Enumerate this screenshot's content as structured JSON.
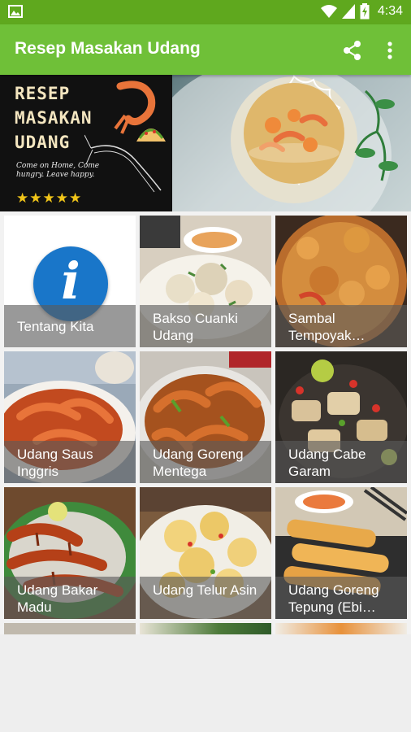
{
  "status_bar": {
    "time": "4:34",
    "icons": [
      "image-icon",
      "wifi-icon",
      "signal-icon",
      "battery-charging-icon"
    ]
  },
  "app_bar": {
    "title": "Resep Masakan Udang",
    "actions": [
      "share-icon",
      "more-vert-icon"
    ]
  },
  "banner": {
    "title_lines": [
      "RESEP",
      "MASAKAN",
      "UDANG"
    ],
    "tagline": "Come on Home, Come hungry. Leave happy.",
    "stars": "★★★★★",
    "rating": 5
  },
  "tiles": [
    {
      "label": "Tentang Kita",
      "icon": "info-icon"
    },
    {
      "label": "Bakso Cuanki Udang"
    },
    {
      "label": "Sambal Tempoyak…"
    },
    {
      "label": "Udang Saus Inggris"
    },
    {
      "label": "Udang Goreng Mentega"
    },
    {
      "label": "Udang Cabe Garam"
    },
    {
      "label": "Udang Bakar Madu"
    },
    {
      "label": "Udang Telur Asin"
    },
    {
      "label": "Udang Goreng Tepung (Ebi…"
    }
  ],
  "colors": {
    "status_bar": "#5fa81e",
    "app_bar": "#6fc038",
    "info_icon": "#1976c9",
    "background": "#eeeeee"
  }
}
